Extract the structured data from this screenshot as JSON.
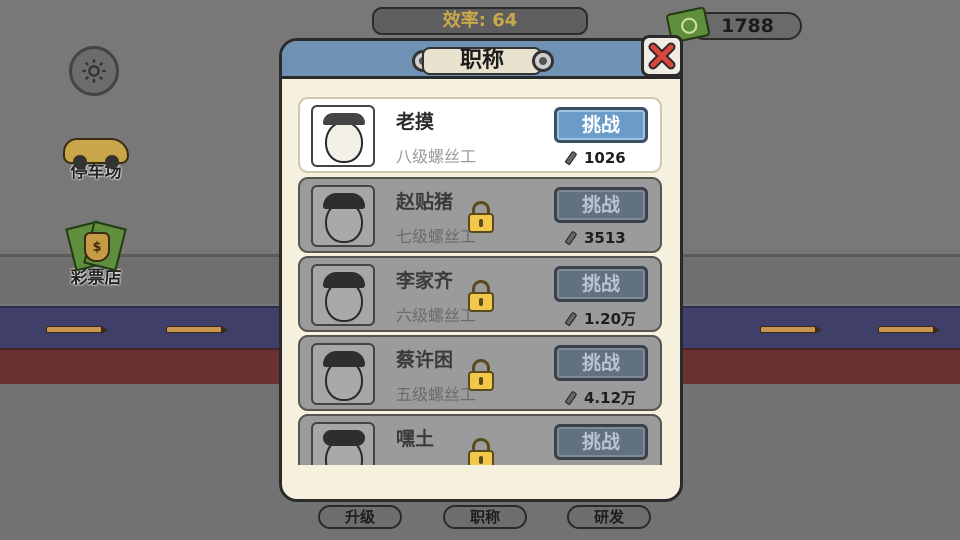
{
  "hud": {
    "efficiency": "效率: 64",
    "money": "1788"
  },
  "side": {
    "parking_label": "停车场",
    "lottery_label": "彩票店",
    "lottery_symbol": "$"
  },
  "dialog": {
    "title": "职称",
    "close_icon": "close-x-icon",
    "rows": [
      {
        "name": "老摸",
        "rank": "八级螺丝工",
        "button": "挑战",
        "cost": "1026",
        "locked": false
      },
      {
        "name": "赵贴猪",
        "rank": "七级螺丝工",
        "button": "挑战",
        "cost": "3513",
        "locked": true
      },
      {
        "name": "李家齐",
        "rank": "六级螺丝工",
        "button": "挑战",
        "cost": "1.20万",
        "locked": true
      },
      {
        "name": "蔡许困",
        "rank": "五级螺丝工",
        "button": "挑战",
        "cost": "4.12万",
        "locked": true
      },
      {
        "name": "嘿土",
        "rank": "",
        "button": "挑战",
        "cost": "",
        "locked": true
      }
    ]
  },
  "tabs": {
    "upgrade": "升级",
    "title": "职称",
    "research": "研发"
  },
  "colors": {
    "challenge_active": "#6b9bc9",
    "challenge_locked": "#617181",
    "header_blue": "#6f92b4",
    "close_red": "#d9473f"
  }
}
